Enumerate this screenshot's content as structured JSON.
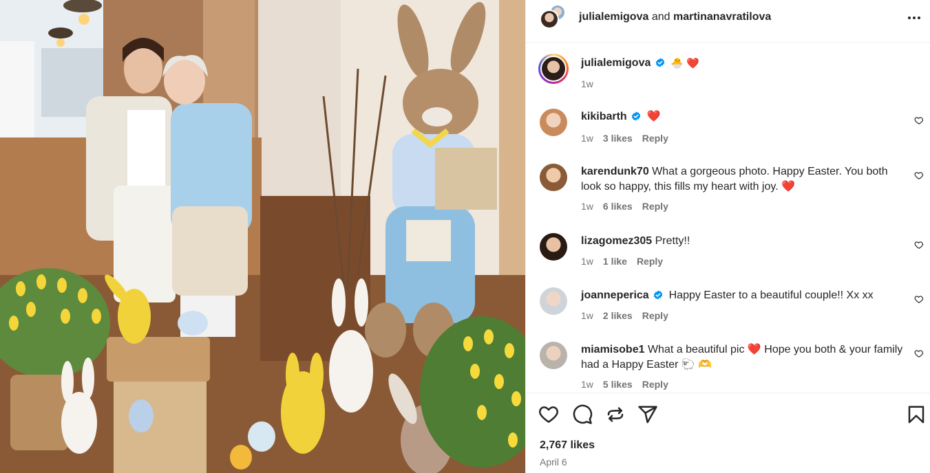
{
  "header": {
    "user1": "julialemigova",
    "joiner": "and",
    "user2": "martinanavratilova"
  },
  "caption": {
    "username": "julialemigova",
    "emoji1": "🐣",
    "emoji2": "❤️",
    "time": "1w"
  },
  "comments": [
    {
      "username": "kikibarth",
      "verified": true,
      "text": "❤️",
      "time": "1w",
      "likes": "3 likes",
      "reply": "Reply"
    },
    {
      "username": "karendunk70",
      "verified": false,
      "text": "What a gorgeous photo. Happy Easter. You both look so happy, this fills my heart with joy. ❤️",
      "time": "1w",
      "likes": "6 likes",
      "reply": "Reply"
    },
    {
      "username": "lizagomez305",
      "verified": false,
      "text": "Pretty!!",
      "time": "1w",
      "likes": "1 like",
      "reply": "Reply"
    },
    {
      "username": "joanneperica",
      "verified": true,
      "text": "Happy Easter to a beautiful couple!! Xx xx",
      "time": "1w",
      "likes": "2 likes",
      "reply": "Reply"
    },
    {
      "username": "miamisobe1",
      "verified": false,
      "text": "What a beautiful pic ❤️ Hope you both & your family had a Happy Easter 🐑 🫶",
      "time": "1w",
      "likes": "5 likes",
      "reply": "Reply"
    }
  ],
  "footer": {
    "likes": "2,767 likes",
    "date": "April 6"
  },
  "colors": {
    "text": "#262626",
    "muted": "#737373",
    "verified": "#0095f6",
    "heart": "#ed1c2e"
  },
  "icons": [
    "more-options-icon",
    "verified-badge-icon",
    "heart-icon",
    "comment-icon",
    "repost-icon",
    "share-icon",
    "save-icon"
  ]
}
